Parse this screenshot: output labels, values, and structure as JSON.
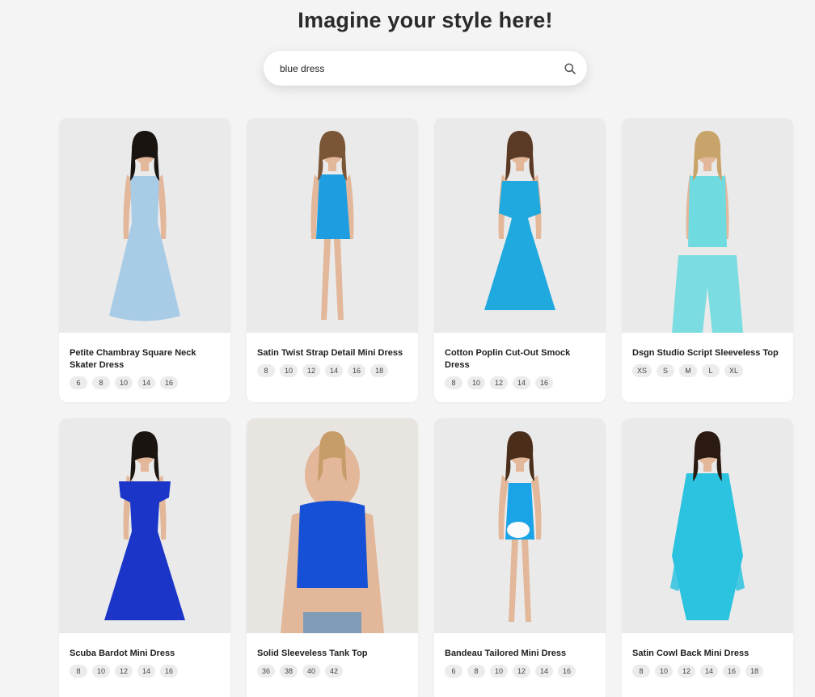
{
  "header": {
    "title": "Imagine your style here!"
  },
  "search": {
    "value": "blue dress",
    "placeholder": ""
  },
  "products": [
    {
      "title": "Petite Chambray Square Neck Skater Dress",
      "sizes": [
        "6",
        "8",
        "10",
        "14",
        "16"
      ],
      "color": "#a8cbe6",
      "style": "skater"
    },
    {
      "title": "Satin Twist Strap Detail Mini Dress",
      "sizes": [
        "8",
        "10",
        "12",
        "14",
        "16",
        "18"
      ],
      "color": "#1e9de0",
      "style": "slip"
    },
    {
      "title": "Cotton Poplin Cut-Out Smock Dress",
      "sizes": [
        "8",
        "10",
        "12",
        "14",
        "16"
      ],
      "color": "#1fa9de",
      "style": "cutout"
    },
    {
      "title": "Dsgn Studio Script Sleeveless Top",
      "sizes": [
        "XS",
        "S",
        "M",
        "L",
        "XL"
      ],
      "color": "#6fdbe0",
      "style": "set"
    },
    {
      "title": "Scuba Bardot Mini Dress",
      "sizes": [
        "8",
        "10",
        "12",
        "14",
        "16"
      ],
      "color": "#1a35c8",
      "style": "bardot"
    },
    {
      "title": "Solid Sleeveless Tank Top",
      "sizes": [
        "36",
        "38",
        "40",
        "42"
      ],
      "color": "#1650d6",
      "style": "tank"
    },
    {
      "title": "Bandeau Tailored Mini Dress",
      "sizes": [
        "6",
        "8",
        "10",
        "12",
        "14",
        "16"
      ],
      "color": "#1aa3e6",
      "style": "bandeau"
    },
    {
      "title": "Satin Cowl Back Mini Dress",
      "sizes": [
        "8",
        "10",
        "12",
        "14",
        "16",
        "18"
      ],
      "color": "#2bc3df",
      "style": "satin"
    }
  ]
}
